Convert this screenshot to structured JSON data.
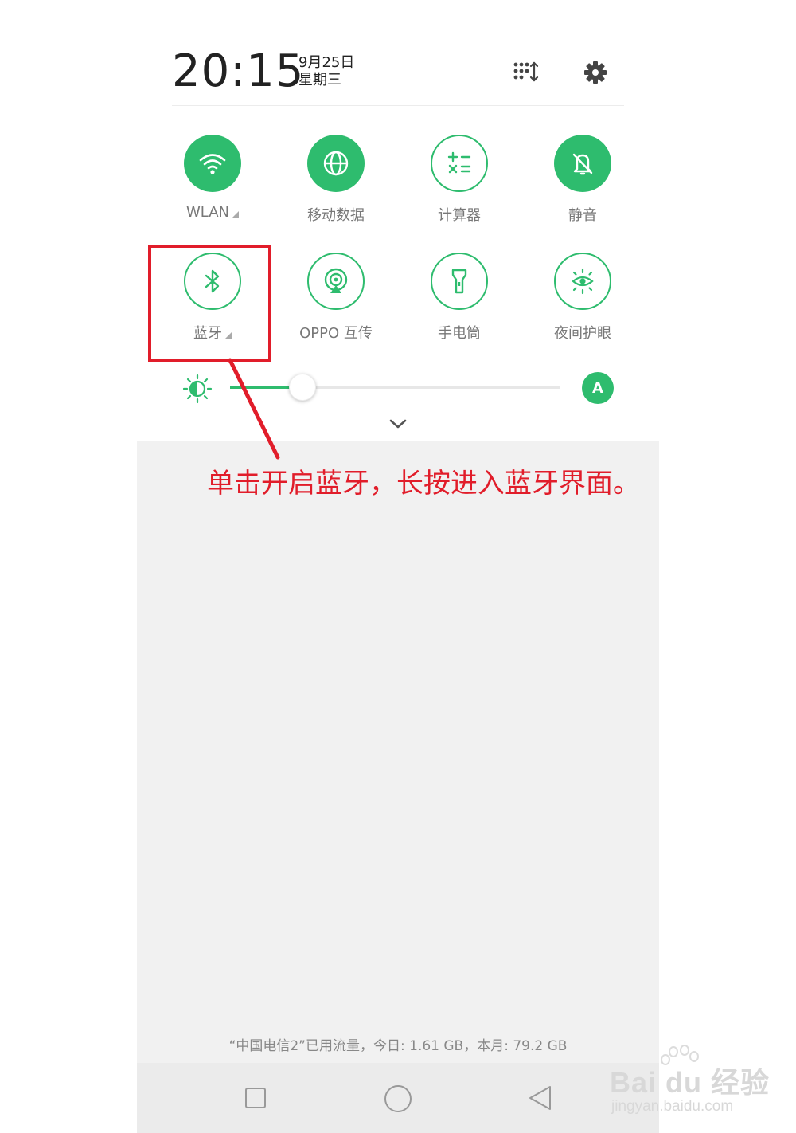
{
  "status": {
    "time": "20:15",
    "date": "9月25日",
    "weekday": "星期三"
  },
  "header_icons": {
    "edit": "grid-sort-icon",
    "settings": "gear-icon"
  },
  "tiles": [
    {
      "label": "WLAN",
      "icon": "wifi-icon",
      "state": "on",
      "has_more": true
    },
    {
      "label": "移动数据",
      "icon": "globe-icon",
      "state": "on",
      "has_more": false
    },
    {
      "label": "计算器",
      "icon": "calculator-icon",
      "state": "off",
      "has_more": false
    },
    {
      "label": "静音",
      "icon": "bell-mute-icon",
      "state": "on",
      "has_more": false
    },
    {
      "label": "蓝牙",
      "icon": "bluetooth-icon",
      "state": "off",
      "has_more": true
    },
    {
      "label": "OPPO 互传",
      "icon": "share-icon",
      "state": "off",
      "has_more": false
    },
    {
      "label": "手电筒",
      "icon": "flashlight-icon",
      "state": "off",
      "has_more": false
    },
    {
      "label": "夜间护眼",
      "icon": "eye-care-icon",
      "state": "off",
      "has_more": false
    }
  ],
  "brightness": {
    "level": 0.22,
    "auto_label": "A"
  },
  "usage_text": "“中国电信2”已用流量，今日: 1.61 GB，本月: 79.2 GB",
  "annotation": "单击开启蓝牙，长按进入蓝牙界面。",
  "watermark": {
    "main": "Bai du 经验",
    "sub": "jingyan.baidu.com"
  },
  "colors": {
    "accent": "#2ebc6e",
    "annotation": "#e11d2a"
  }
}
